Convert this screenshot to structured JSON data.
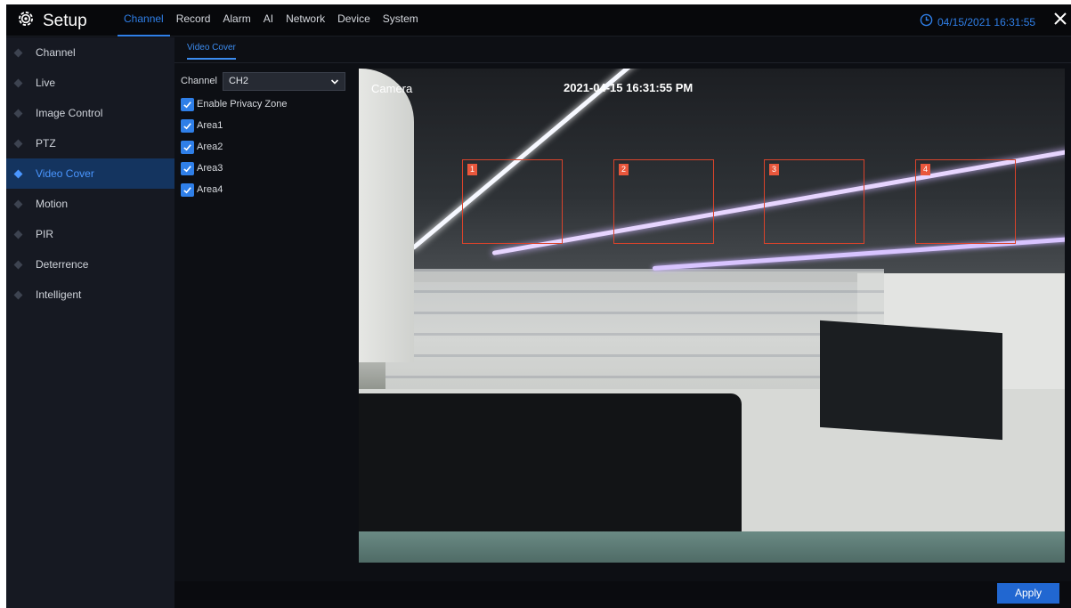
{
  "app": {
    "title": "Setup"
  },
  "nav": {
    "items": [
      {
        "label": "Channel",
        "active": true
      },
      {
        "label": "Record",
        "active": false
      },
      {
        "label": "Alarm",
        "active": false
      },
      {
        "label": "AI",
        "active": false
      },
      {
        "label": "Network",
        "active": false
      },
      {
        "label": "Device",
        "active": false
      },
      {
        "label": "System",
        "active": false
      }
    ]
  },
  "clock": {
    "datetime": "04/15/2021 16:31:55"
  },
  "sidebar": {
    "items": [
      {
        "label": "Channel",
        "active": false
      },
      {
        "label": "Live",
        "active": false
      },
      {
        "label": "Image Control",
        "active": false
      },
      {
        "label": "PTZ",
        "active": false
      },
      {
        "label": "Video Cover",
        "active": true
      },
      {
        "label": "Motion",
        "active": false
      },
      {
        "label": "PIR",
        "active": false
      },
      {
        "label": "Deterrence",
        "active": false
      },
      {
        "label": "Intelligent",
        "active": false
      }
    ]
  },
  "tab": {
    "label": "Video Cover"
  },
  "form": {
    "channel_label": "Channel",
    "channel_value": "CH2",
    "enable_privacy_zone": {
      "label": "Enable Privacy Zone",
      "checked": true
    },
    "areas": [
      {
        "label": "Area1",
        "checked": true
      },
      {
        "label": "Area2",
        "checked": true
      },
      {
        "label": "Area3",
        "checked": true
      },
      {
        "label": "Area4",
        "checked": true
      }
    ]
  },
  "preview": {
    "camera_label": "Camera",
    "timestamp": "2021-04-15 16:31:55 PM",
    "zones": [
      "1",
      "2",
      "3",
      "4"
    ]
  },
  "footer": {
    "apply_label": "Apply"
  },
  "colors": {
    "accent": "#2f7fe8",
    "zone_border": "#d9432b",
    "apply_bg": "#2167d1"
  }
}
